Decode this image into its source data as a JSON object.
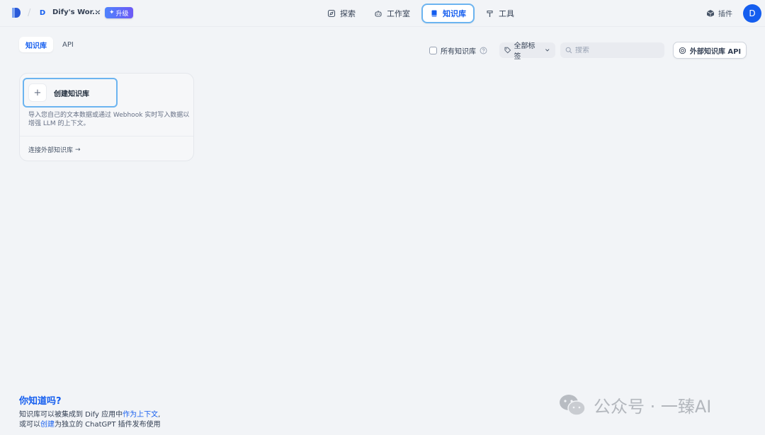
{
  "header": {
    "workspace_initial": "D",
    "workspace_name": "Dify's Wor...",
    "upgrade_label": "升级",
    "nav": [
      {
        "label": "探索",
        "icon": "compass-icon"
      },
      {
        "label": "工作室",
        "icon": "robot-icon"
      },
      {
        "label": "知识库",
        "icon": "book-icon",
        "active": true
      },
      {
        "label": "工具",
        "icon": "hammer-icon"
      }
    ],
    "plugins_label": "插件",
    "user_initial": "D"
  },
  "tabs": [
    {
      "label": "知识库",
      "active": true
    },
    {
      "label": "API",
      "active": false
    }
  ],
  "toolbar": {
    "all_knowledge_label": "所有知识库",
    "tags_label": "全部标签",
    "search_placeholder": "搜索",
    "external_api_label": "外部知识库 API"
  },
  "create_card": {
    "title": "创建知识库",
    "description": "导入您自己的文本数据或通过 Webhook 实时写入数据以增强 LLM 的上下文。",
    "connect_label": "连接外部知识库",
    "arrow": "→"
  },
  "tip": {
    "title": "你知道吗?",
    "line1_prefix": "知识库可以被集成到 Dify 应用中",
    "line1_link": "作为上下文",
    "line1_suffix": ",",
    "line2_prefix": "或可以",
    "line2_link": "创建",
    "line2_suffix": "为独立的 ChatGPT 插件发布使用"
  },
  "watermark": {
    "text": "公众号 · 一臻AI"
  },
  "colors": {
    "accent": "#155eef",
    "highlight_border": "#6cb4f0",
    "background": "#f2f4f7"
  }
}
